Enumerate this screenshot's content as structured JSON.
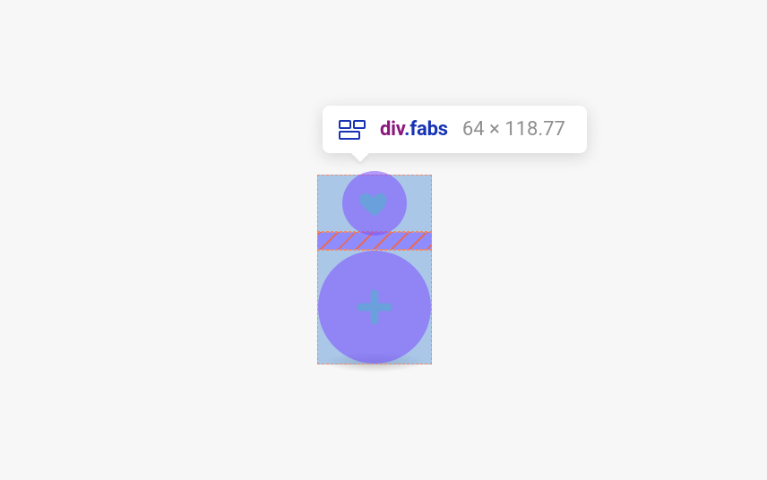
{
  "tooltip": {
    "tag": "div",
    "class": ".fabs",
    "dimensions": "64 × 118.77"
  },
  "fabs": {
    "small_icon_name": "heart",
    "large_icon_name": "plus"
  }
}
